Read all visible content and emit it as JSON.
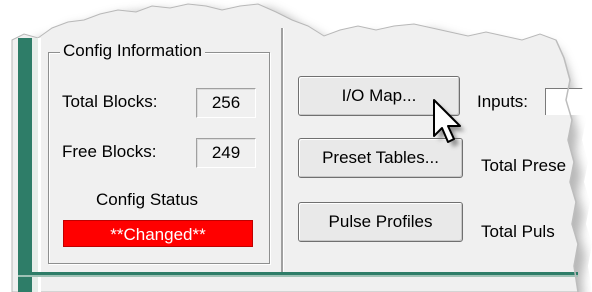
{
  "config_group": {
    "title": "Config Information",
    "total_blocks_label": "Total Blocks:",
    "total_blocks_value": "256",
    "free_blocks_label": "Free Blocks:",
    "free_blocks_value": "249",
    "status_label": "Config Status",
    "status_value": "**Changed**"
  },
  "buttons": {
    "io_map": "I/O Map...",
    "preset_tables": "Preset Tables...",
    "pulse_profiles": "Pulse Profiles"
  },
  "right_labels": {
    "inputs": "Inputs:",
    "total_preset": "Total Prese",
    "total_pulse": "Total Puls"
  },
  "colors": {
    "window_bg": "#f0f0f0",
    "frame_teal": "#2e7d68",
    "status_bg": "#ff0000",
    "status_text": "#ffffff"
  },
  "icons": {
    "cursor": "arrow-pointer-icon"
  }
}
